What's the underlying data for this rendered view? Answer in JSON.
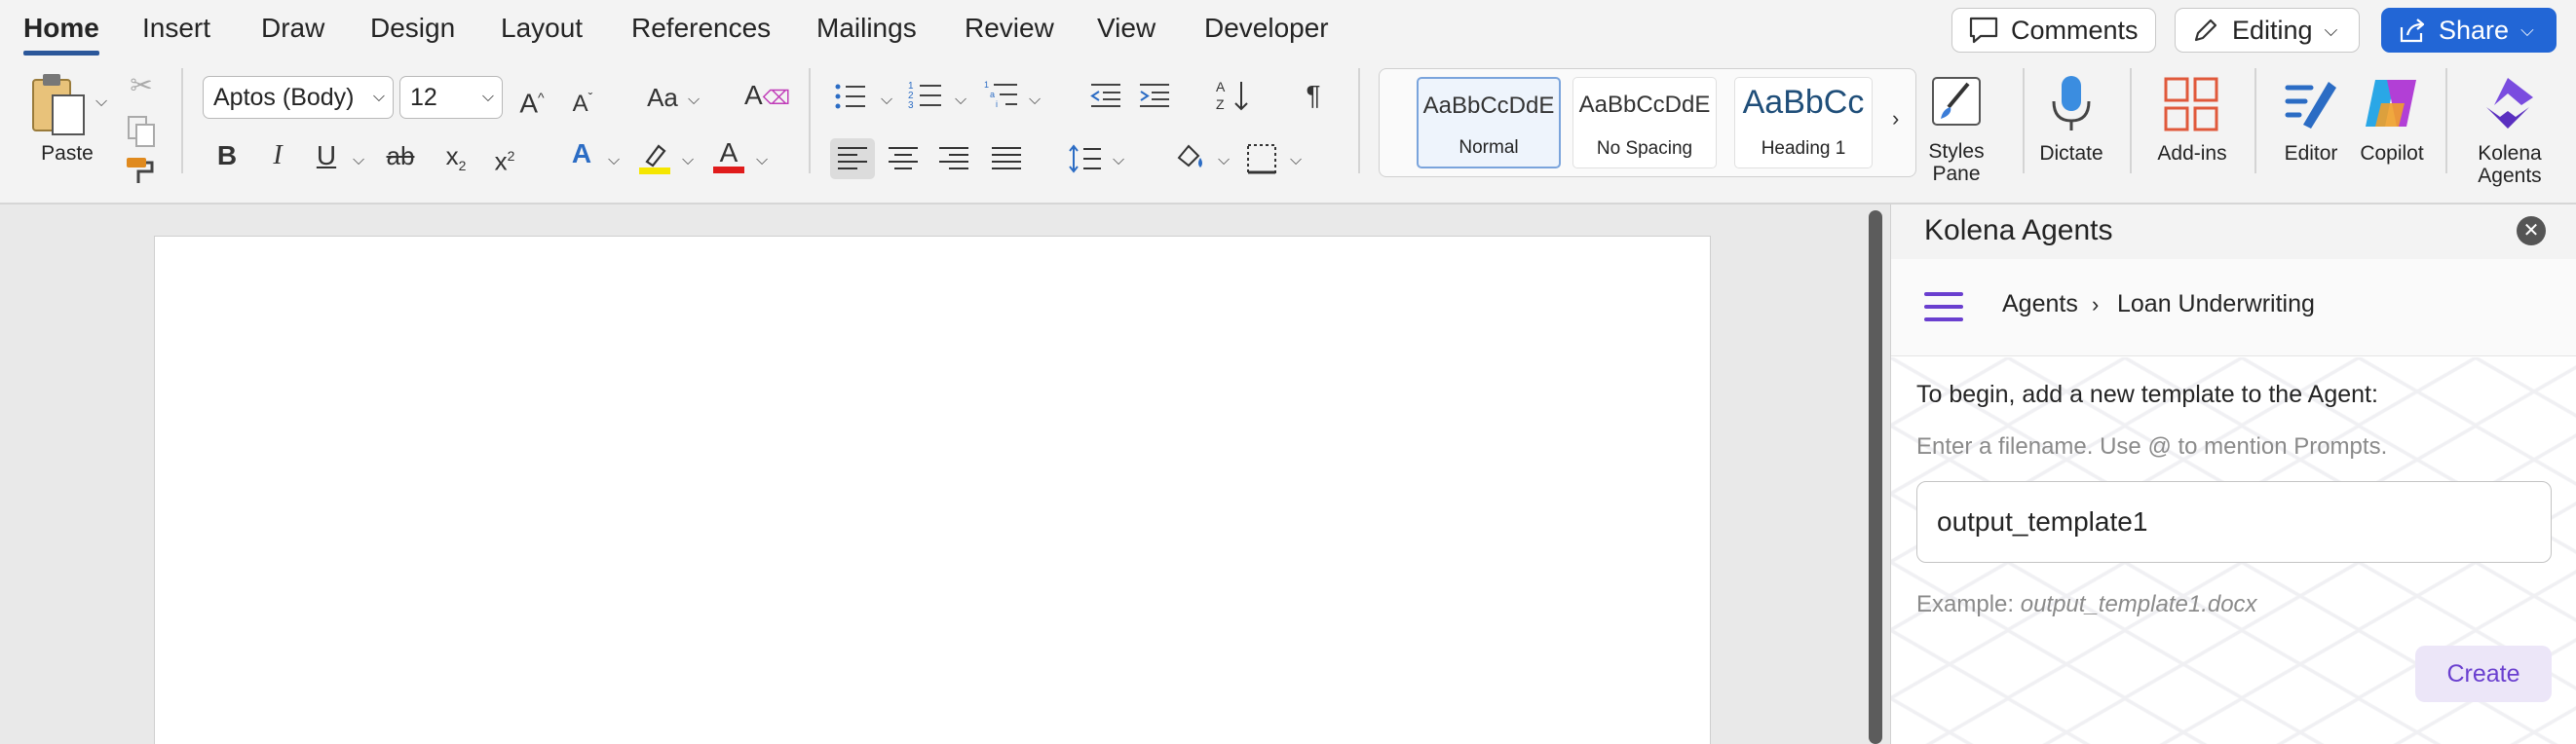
{
  "tabs": [
    {
      "label": "Home",
      "active": true
    },
    {
      "label": "Insert"
    },
    {
      "label": "Draw"
    },
    {
      "label": "Design"
    },
    {
      "label": "Layout"
    },
    {
      "label": "References"
    },
    {
      "label": "Mailings"
    },
    {
      "label": "Review"
    },
    {
      "label": "View"
    },
    {
      "label": "Developer"
    }
  ],
  "top_actions": {
    "comments": "Comments",
    "editing": "Editing",
    "share": "Share"
  },
  "ribbon": {
    "paste": "Paste",
    "font_name": "Aptos (Body)",
    "font_size": "12",
    "change_case": "Aa",
    "styles": [
      {
        "preview": "AaBbCcDdE",
        "name": "Normal",
        "selected": true
      },
      {
        "preview": "AaBbCcDdE",
        "name": "No Spacing"
      },
      {
        "preview": "AaBbCc",
        "name": "Heading 1"
      }
    ],
    "styles_pane": [
      "Styles",
      "Pane"
    ],
    "dictate": "Dictate",
    "addins": "Add-ins",
    "editor": "Editor",
    "copilot": "Copilot",
    "kolena_agents": [
      "Kolena",
      "Agents"
    ]
  },
  "pane": {
    "title": "Kolena Agents",
    "breadcrumb": [
      "Agents",
      "Loan Underwriting"
    ],
    "intro": "To begin, add a new template to the Agent:",
    "hint": "Enter a filename. Use @ to mention Prompts.",
    "filename_value": "output_template1",
    "example_label": "Example:",
    "example_value": "output_template1.docx",
    "create_label": "Create"
  },
  "colors": {
    "accent_blue": "#2266d6",
    "accent_purple": "#6a3fcf",
    "font_color_red": "#e01b1b",
    "highlight_yellow": "#f5e600"
  }
}
